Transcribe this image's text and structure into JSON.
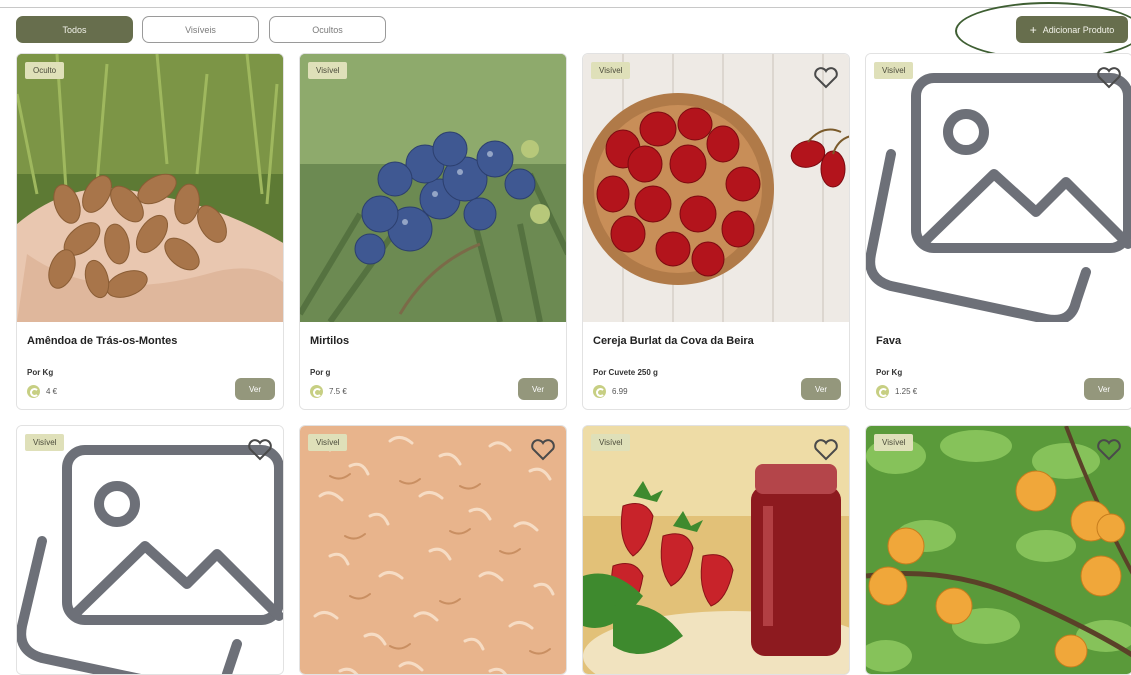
{
  "filters": {
    "all": "Todos",
    "visible": "Visíveis",
    "hidden": "Ocultos"
  },
  "actions": {
    "add_product": "Adicionar Produto"
  },
  "products": [
    {
      "status": "Oculto",
      "name": "Amêndoa de Trás-os-Montes",
      "unit": "Por Kg",
      "price": "4 €",
      "view": "Ver",
      "image": "almonds-photo"
    },
    {
      "status": "Visível",
      "name": "Mirtilos",
      "unit": "Por g",
      "price": "7.5 €",
      "view": "Ver",
      "image": "blueberries-photo"
    },
    {
      "status": "Visível",
      "name": "Cereja Burlat da Cova da Beira",
      "unit": "Por Cuvete 250 g",
      "price": "6.99",
      "view": "Ver",
      "image": "cherries-photo"
    },
    {
      "status": "Visível",
      "name": "Fava",
      "unit": "Por Kg",
      "price": "1.25 €",
      "view": "Ver",
      "image": "placeholder-image"
    },
    {
      "status": "Visível",
      "image": "placeholder-image"
    },
    {
      "status": "Visível",
      "image": "wood-shavings-photo"
    },
    {
      "status": "Visível",
      "image": "strawberry-jam-photo"
    },
    {
      "status": "Visível",
      "image": "apricot-tree-photo"
    }
  ],
  "colors": {
    "accent": "#676e4d",
    "badge": "#dfe0b9",
    "view_button": "#94977c",
    "coin": "#c7cf83"
  }
}
